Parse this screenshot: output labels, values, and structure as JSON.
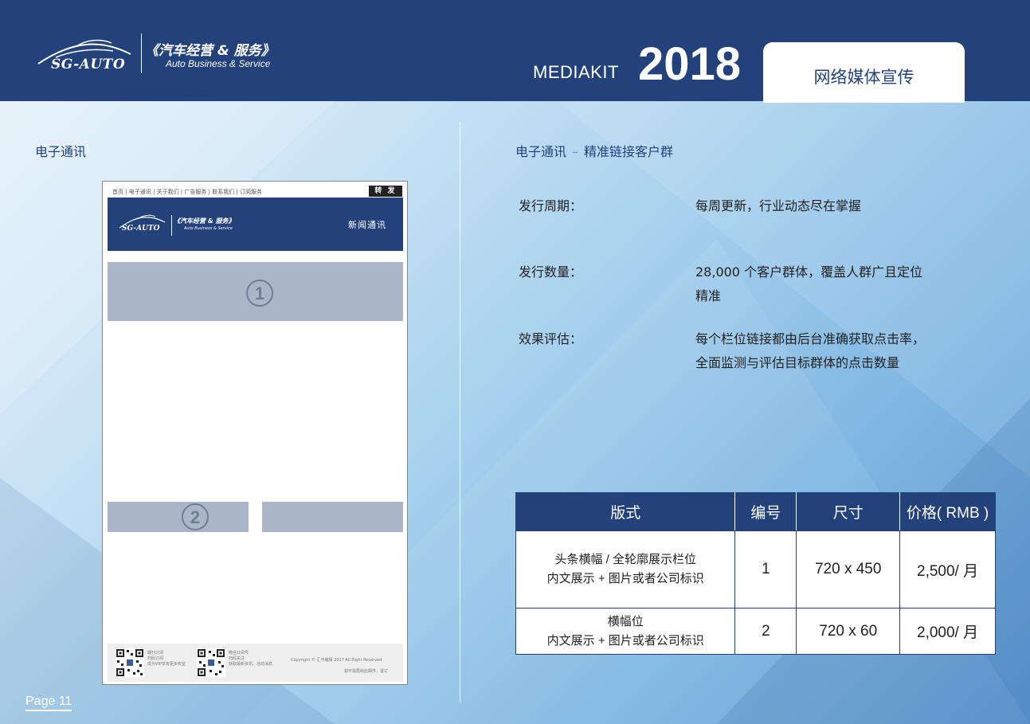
{
  "header": {
    "logo_brand": "SG-AUTO",
    "logo_cn": "《汽车经营 & 服务》",
    "logo_en": "Auto Business & Service",
    "mediakit_label": "MEDIAKIT",
    "year": "2018",
    "tab_label": "网络媒体宣传"
  },
  "left": {
    "section_title": "电子通讯"
  },
  "newsletter": {
    "nav": "首页 | 电子通讯 | 关于我们 | 广告服务 | 联系我们 | 订阅服务",
    "forward_button": "转 发",
    "brand": "SG-AUTO",
    "logo_cn": "《汽车经营 & 服务》",
    "logo_en": "Auto Business & Service",
    "header_right": "新闻通讯",
    "slot1_number": "1",
    "slot2_number": "2",
    "footer": {
      "qr1_title": "期刊订阅",
      "qr1_line1": "扫码订阅",
      "qr1_line2": "成为VIP享有更多权益",
      "qr2_title": "微信订阅号",
      "qr2_line1": "扫码关注",
      "qr2_line2": "获取最新资讯、活动消息",
      "copyright": "Copyright © 汇中编辑 2017 All Right Reserved",
      "unsubscribe": "如不需再收此邮件，退订"
    }
  },
  "right": {
    "title_main": "电子通讯",
    "title_separator": "–",
    "title_sub": "精准链接客户群",
    "rows": [
      {
        "label": "发行周期：",
        "value": "每周更新，行业动态尽在掌握"
      },
      {
        "label": "发行数量：",
        "value": "28,000 个客户群体，覆盖人群广且定位精准"
      },
      {
        "label": "效果评估：",
        "value": "每个栏位链接都由后台准确获取点击率，全面监测与评估目标群体的点击数量"
      }
    ]
  },
  "table": {
    "headers": [
      "版式",
      "编号",
      "尺寸",
      "价格( RMB )"
    ],
    "rows": [
      {
        "format_line1": "头条横幅 / 全轮廓展示栏位",
        "format_line2": "内文展示 + 图片或者公司标识",
        "number": "1",
        "size": "720 x 450",
        "price": "2,500/ 月"
      },
      {
        "format_line1": "横幅位",
        "format_line2": "内文展示 + 图片或者公司标识",
        "number": "2",
        "size": "720 x 60",
        "price": "2,000/ 月"
      }
    ]
  },
  "footer": {
    "page_label": "Page 11"
  },
  "colors": {
    "navy": "#23427b",
    "slot_gray": "#aab6c8",
    "background_light": "#e9f3fb",
    "background_dark": "#5b95cf"
  }
}
